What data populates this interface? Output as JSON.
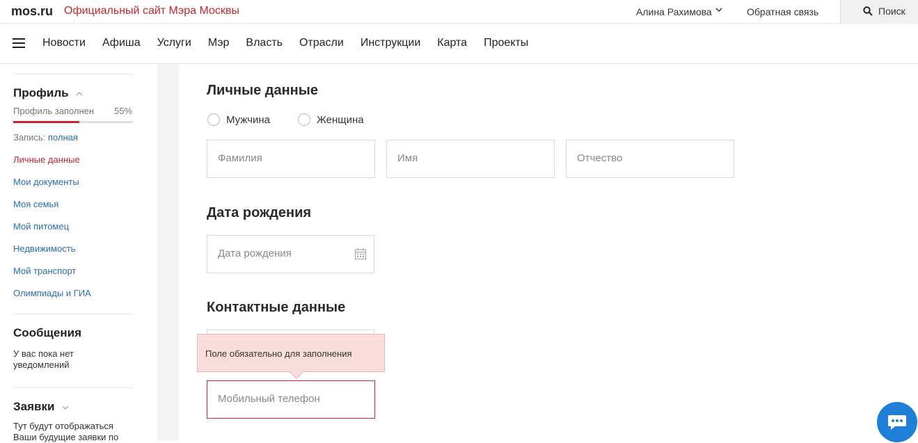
{
  "header": {
    "logo": "mos.ru",
    "site_title": "Официальный сайт Мэра Москвы",
    "user_name": "Алина Рахимова",
    "feedback": "Обратная связь",
    "search": "Поиск"
  },
  "nav": {
    "items": [
      "Новости",
      "Афиша",
      "Услуги",
      "Мэр",
      "Власть",
      "Отрасли",
      "Инструкции",
      "Карта",
      "Проекты"
    ]
  },
  "sidebar": {
    "profile_title": "Профиль",
    "progress_label": "Профиль заполнен",
    "progress_value": "55%",
    "progress_fraction": 0.55,
    "record_label": "Запись:",
    "record_value": "полная",
    "links": [
      "Личные данные",
      "Мои документы",
      "Моя семья",
      "Мой питомец",
      "Недвижимость",
      "Мой транспорт",
      "Олимпиады и ГИА"
    ],
    "messages_title": "Сообщения",
    "messages_text": "У вас пока нет уведомлений",
    "requests_title": "Заявки",
    "requests_text": "Тут будут отображаться Ваши будущие заявки по"
  },
  "main": {
    "personal_title": "Личные данные",
    "gender_male": "Мужчина",
    "gender_female": "Женщина",
    "surname_placeholder": "Фамилия",
    "name_placeholder": "Имя",
    "patronymic_placeholder": "Отчество",
    "birth_title": "Дата рождения",
    "birth_placeholder": "Дата рождения",
    "contacts_title": "Контактные данные",
    "error_tooltip": "Поле обязательно для заполнения",
    "phone_placeholder": "Мобильный телефон"
  },
  "colors": {
    "brand_red": "#c8262e",
    "link_blue": "#2a6db3",
    "chat_blue": "#1f7fd6",
    "error_bg": "#f9dcdc"
  },
  "icons": [
    "chevron-down-icon",
    "search-icon",
    "menu-icon",
    "calendar-icon",
    "chat-icon"
  ]
}
